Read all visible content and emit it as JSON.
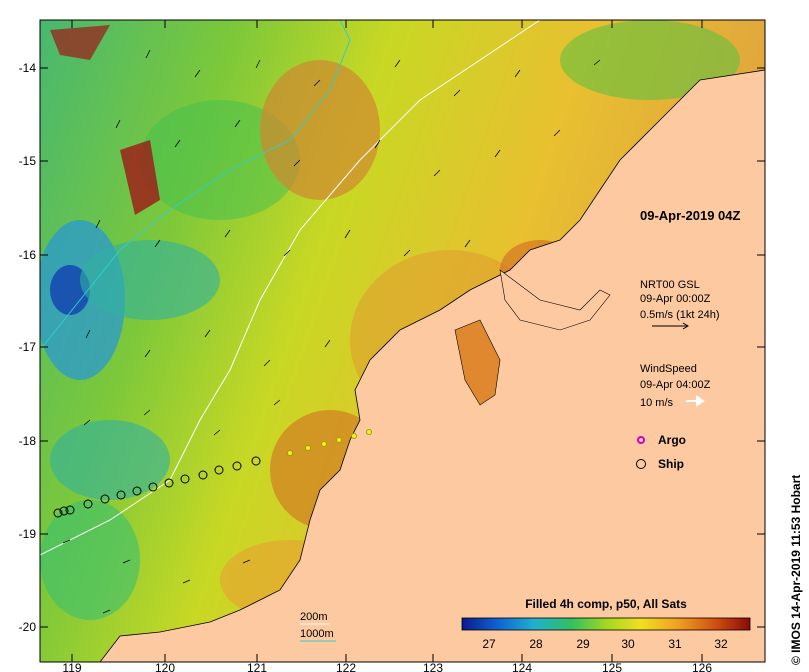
{
  "map": {
    "datetime_label": "09-Apr-2019 04Z",
    "current_legend": {
      "line1": "NRT00 GSL",
      "line2": "09-Apr 00:00Z",
      "line3": "0.5m/s (1kt 24h)"
    },
    "wind_legend": {
      "line1": "WindSpeed",
      "line2": "09-Apr 04:00Z",
      "line3": "10 m/s"
    },
    "markers": [
      {
        "label": "Argo",
        "color": "#cc00cc"
      },
      {
        "label": "Ship",
        "color": "#000000"
      }
    ],
    "contours": [
      {
        "label": "200m",
        "color": "#ffffff"
      },
      {
        "label": "1000m",
        "color": "#33cccc"
      }
    ],
    "colorbar": {
      "title": "Filled 4h comp, p50, All Sats",
      "ticks": [
        "27",
        "28",
        "29",
        "30",
        "31",
        "32"
      ]
    },
    "x_ticks": [
      "119",
      "120",
      "121",
      "122",
      "123",
      "124",
      "125",
      "126"
    ],
    "y_ticks": [
      "-14",
      "-15",
      "-16",
      "-17",
      "-18",
      "-19",
      "-20"
    ],
    "credit": "© IMOS 14-Apr-2019 11:53 Hobart"
  },
  "colors": {
    "land": "#fcc9a1",
    "cbar_stops": [
      "#0a1a8c",
      "#1060d0",
      "#20b0d0",
      "#30c060",
      "#a0d820",
      "#f0e020",
      "#f0a020",
      "#d05010",
      "#8c0a0a"
    ]
  }
}
